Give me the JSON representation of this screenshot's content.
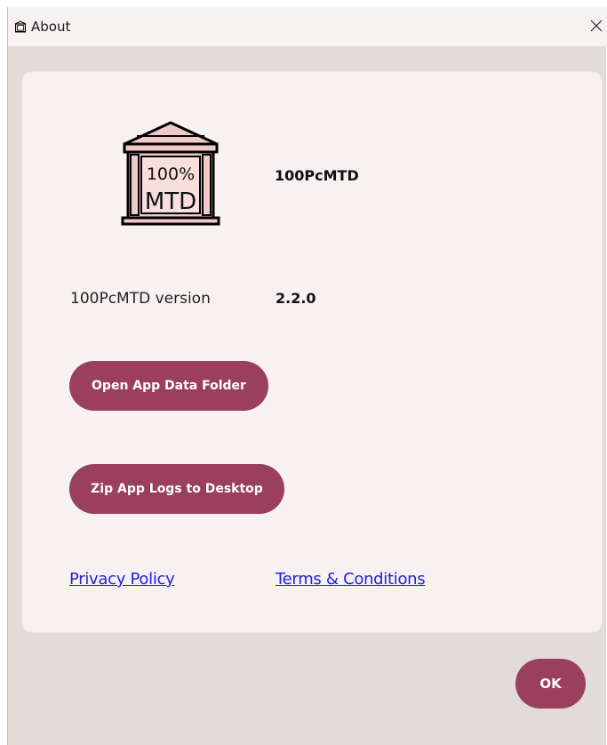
{
  "window": {
    "title": "About",
    "close_glyph": "✕"
  },
  "app": {
    "logo_line1": "100%",
    "logo_line2": "MTD",
    "name": "100PcMTD",
    "version_label": "100PcMTD version",
    "version_value": "2.2.0"
  },
  "actions": {
    "open_data_folder": "Open App Data Folder",
    "zip_logs": "Zip App Logs to Desktop"
  },
  "links": {
    "privacy": "Privacy Policy",
    "terms": "Terms & Conditions"
  },
  "footer": {
    "ok": "OK"
  },
  "colors": {
    "accent": "#9b3f5e",
    "dialog_bg": "#e3dada",
    "card_bg": "#f7f1f1",
    "logo_fill": "#f2c9c9",
    "link": "#2222dd"
  },
  "icons": {
    "title_icon": "bank-building-icon",
    "close": "close-icon",
    "logo": "bank-building-logo"
  }
}
